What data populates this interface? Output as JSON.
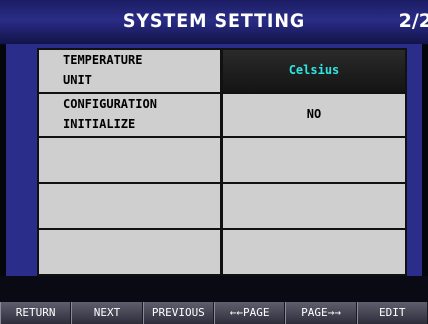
{
  "header": {
    "title": "SYSTEM SETTING",
    "page_indicator": "2/2"
  },
  "settings": [
    {
      "label_line1": "TEMPERATURE",
      "label_line2": "UNIT",
      "value": "Celsius",
      "highlighted": true
    },
    {
      "label_line1": "CONFIGURATION",
      "label_line2": "INITIALIZE",
      "value": "NO",
      "highlighted": false
    },
    {
      "label_line1": "",
      "label_line2": "",
      "value": ""
    },
    {
      "label_line1": "",
      "label_line2": "",
      "value": ""
    },
    {
      "label_line1": "",
      "label_line2": "",
      "value": ""
    }
  ],
  "footer": {
    "return_label": "RETURN",
    "next_label": "NEXT",
    "previous_label": "PREVIOUS",
    "page_back_label": "←←PAGE",
    "page_forward_label": "PAGE→→",
    "edit_label": "EDIT"
  },
  "colors": {
    "title_bar": "#2a2c86",
    "highlight_value_text": "#2de6e0",
    "cell_background": "#cfcfcf"
  }
}
